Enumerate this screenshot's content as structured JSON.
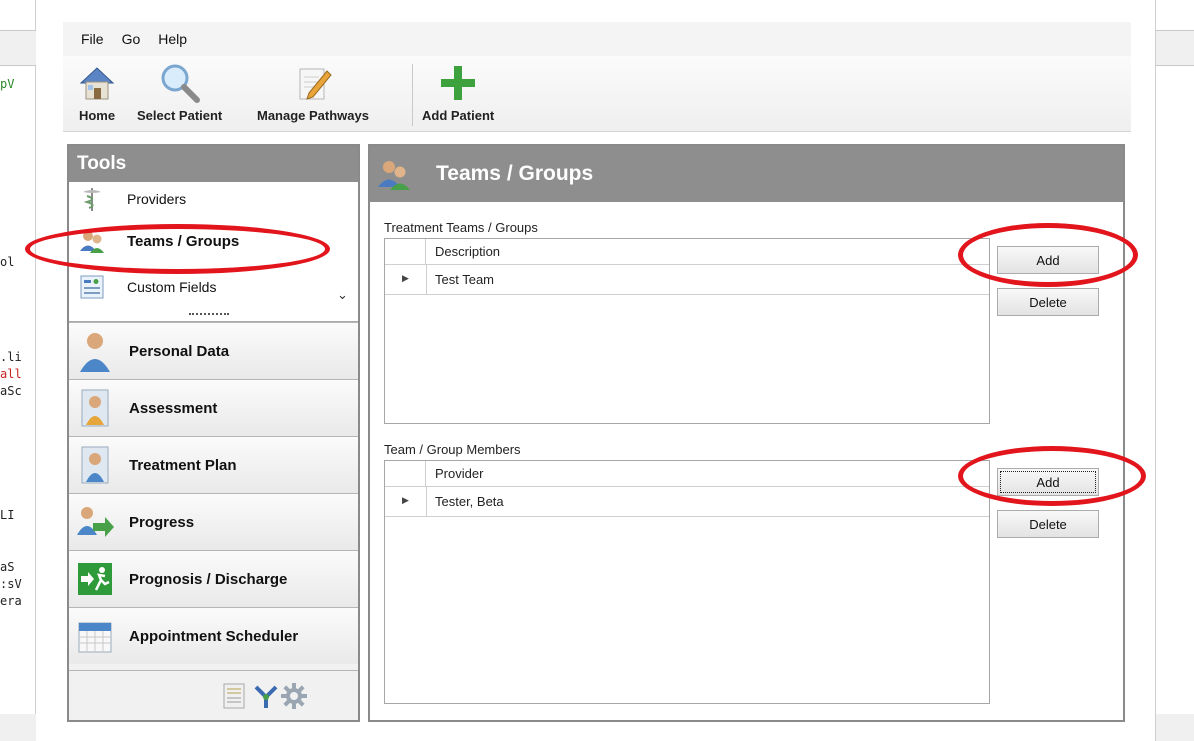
{
  "background_code": {
    "left_lines": [
      {
        "text": "pV",
        "color": "#2b8a2b"
      },
      {
        "text": "ol",
        "color": "#222222"
      },
      {
        "text": ".li",
        "color": "#222222"
      },
      {
        "text": "all",
        "color": "#cc2222"
      },
      {
        "text": "aSc",
        "color": "#222222"
      },
      {
        "text": "LI",
        "color": "#222222"
      },
      {
        "text": "aS",
        "color": "#222222"
      },
      {
        "text": ":sV",
        "color": "#222222"
      },
      {
        "text": "era",
        "color": "#222222"
      }
    ]
  },
  "menu": {
    "items": [
      "File",
      "Go",
      "Help"
    ]
  },
  "toolbar": {
    "buttons": [
      {
        "label": "Home",
        "icon": "house-icon"
      },
      {
        "label": "Select Patient",
        "icon": "magnifier-icon"
      },
      {
        "label": "Manage Pathways",
        "icon": "document-pencil-icon"
      },
      {
        "label": "Add Patient",
        "icon": "plus-icon"
      }
    ]
  },
  "tools": {
    "title": "Tools",
    "items": [
      {
        "label": "Providers",
        "icon": "caduceus-icon",
        "active": false
      },
      {
        "label": "Teams / Groups",
        "icon": "people-group-icon",
        "active": true
      },
      {
        "label": "Custom Fields",
        "icon": "form-fields-icon",
        "active": false
      }
    ],
    "nav": [
      {
        "label": "Personal Data",
        "icon": "person-icon"
      },
      {
        "label": "Assessment",
        "icon": "assessment-icon"
      },
      {
        "label": "Treatment Plan",
        "icon": "treatment-plan-icon"
      },
      {
        "label": "Progress",
        "icon": "progress-arrow-icon"
      },
      {
        "label": "Prognosis / Discharge",
        "icon": "exit-icon"
      },
      {
        "label": "Appointment Scheduler",
        "icon": "calendar-icon"
      }
    ],
    "footer_icons": [
      "report-icon",
      "pathway-icon",
      "settings-gear-icon"
    ]
  },
  "content": {
    "title": "Teams / Groups",
    "teams": {
      "label": "Treatment Teams / Groups",
      "column": "Description",
      "rows": [
        "Test Team"
      ],
      "add_label": "Add",
      "delete_label": "Delete"
    },
    "members": {
      "label": "Team / Group Members",
      "column": "Provider",
      "rows": [
        "Tester, Beta"
      ],
      "add_label": "Add",
      "delete_label": "Delete"
    }
  },
  "colors": {
    "header_gray": "#8e8e8e",
    "annotation_red": "#e3151c"
  }
}
